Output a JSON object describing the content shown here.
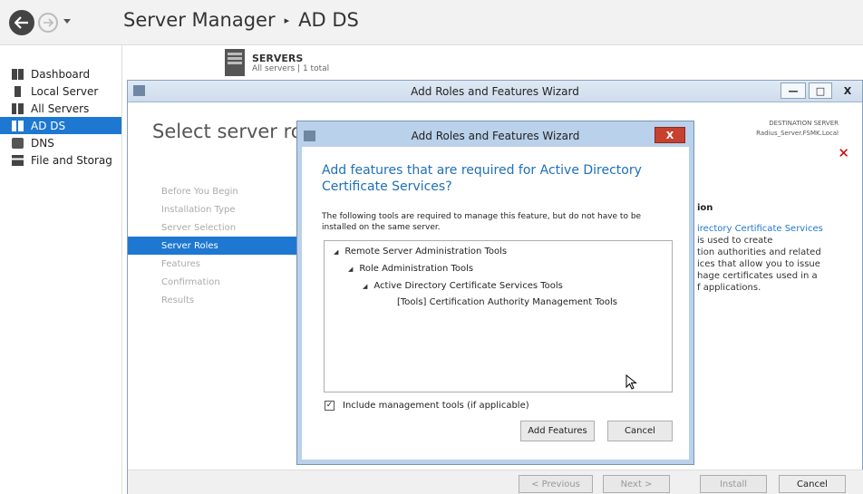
{
  "breadcrumb": {
    "app": "Server Manager",
    "separator": "▸",
    "current": "AD DS"
  },
  "sidebar": {
    "items": [
      {
        "label": "Dashboard",
        "icon": "dashboard-icon"
      },
      {
        "label": "Local Server",
        "icon": "server-icon"
      },
      {
        "label": "All Servers",
        "icon": "servers-icon"
      },
      {
        "label": "AD DS",
        "icon": "ad-ds-icon",
        "active": true
      },
      {
        "label": "DNS",
        "icon": "dns-icon"
      },
      {
        "label": "File and Storag",
        "icon": "storage-icon"
      }
    ]
  },
  "servers_header": {
    "title": "SERVERS",
    "subtitle": "All servers | 1 total"
  },
  "wizard": {
    "title": "Add Roles and Features Wizard",
    "heading": "Select server ro",
    "destination_label": "DESTINATION SERVER",
    "destination_server": "Radius_Server.FSMK.Local",
    "steps": [
      {
        "label": "Before You Begin"
      },
      {
        "label": "Installation Type"
      },
      {
        "label": "Server Selection"
      },
      {
        "label": "Server Roles",
        "active": true
      },
      {
        "label": "Features"
      },
      {
        "label": "Confirmation"
      },
      {
        "label": "Results"
      }
    ],
    "description": {
      "heading": "ion",
      "link": "irectory Certificate Services",
      "lines": [
        "is used to create",
        "tion authorities and related",
        "ices that allow you to issue",
        "hage certificates used in a",
        "f applications."
      ]
    },
    "footer": {
      "previous": "< Previous",
      "next": "Next >",
      "install": "Install",
      "cancel": "Cancel"
    },
    "window_buttons": {
      "minimize": "—",
      "maximize": "□",
      "close": "X"
    }
  },
  "modal": {
    "title": "Add Roles and Features Wizard",
    "close": "X",
    "heading": "Add features that are required for Active Directory Certificate Services?",
    "text": "The following tools are required to manage this feature, but do not have to be installed on the same server.",
    "tree": [
      {
        "label": "Remote Server Administration Tools",
        "expanded": true
      },
      {
        "label": "Role Administration Tools",
        "expanded": true
      },
      {
        "label": "Active Directory Certificate Services Tools",
        "expanded": true
      },
      {
        "label": "[Tools] Certification Authority Management Tools"
      }
    ],
    "checkbox_label": "Include management tools (if applicable)",
    "checkbox_checked": true,
    "checkmark": "✓",
    "add_button": "Add Features",
    "cancel_button": "Cancel",
    "tree_toggle_glyph": "◢"
  },
  "colors": {
    "accent": "#1e78d2",
    "link": "#1e6fb9",
    "danger": "#c7412f"
  }
}
